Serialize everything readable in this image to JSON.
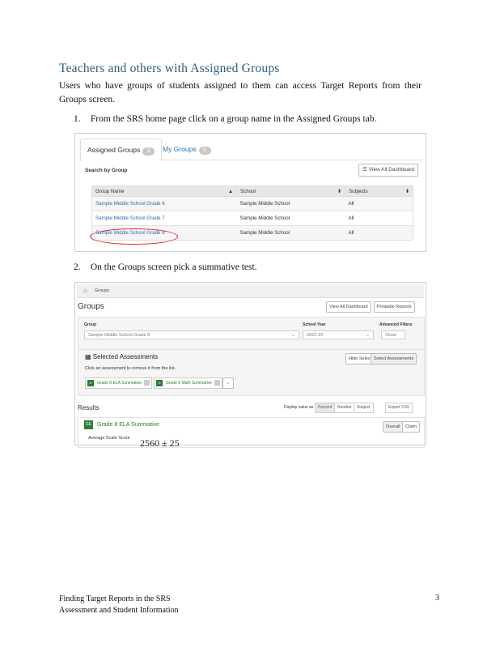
{
  "heading": "Teachers and  others with Assigned Groups",
  "intro": "Users who have groups of students assigned to them can access Target Reports from their Groups screen.",
  "steps": [
    {
      "num": "1.",
      "text": "From the SRS home page click on a group name in the Assigned Groups tab."
    },
    {
      "num": "2.",
      "text": "On the Groups screen pick a summative test."
    }
  ],
  "shot1": {
    "tabs": [
      {
        "label": "Assigned Groups",
        "count": "3"
      },
      {
        "label": "My Groups",
        "count": "0"
      }
    ],
    "search_label": "Search by Group",
    "view_all": "View All Dashboard",
    "columns": [
      "Group Name",
      "School",
      "Subjects"
    ],
    "rows": [
      [
        "Sample Middle School Grade 6",
        "Sample Middle School",
        "All"
      ],
      [
        "Sample Middle School Grade 7",
        "Sample Middle School",
        "All"
      ],
      [
        "Sample Middle School Grade 8",
        "Sample Middle School",
        "All"
      ]
    ]
  },
  "shot2": {
    "breadcrumb": "Groups",
    "title": "Groups",
    "btn_dashboard": "View All Dashboard",
    "btn_print": "Printable Reports",
    "filter_group_label": "Group",
    "filter_group_value": "Sample Middle School Grade 8",
    "filter_year_label": "School Year",
    "filter_year_value": "2022-23",
    "filter_adv_label": "Advanced Filters",
    "filter_adv_value": "Show",
    "sa_title": "Selected Assessments",
    "sa_sub": "Click an assessment to remove it from the list.",
    "btn_hide": "Hide Select",
    "btn_select": "Select Assessments",
    "chips": [
      "Grade 8 ELA Summative",
      "Grade 8 Math Summative"
    ],
    "results": "Results",
    "display_label": "Display value as",
    "seg": [
      "Percent",
      "Number"
    ],
    "btn_subject": "Subject",
    "btn_export": "Export CSV",
    "ge_badge": "GE",
    "ela_title": "Grade 8 ELA Summative",
    "btn_overall": "Overall",
    "btn_claim": "Claim",
    "avg_label": "Average Scale Score",
    "score": "2560 ± 25"
  },
  "footer": [
    "Finding Target Reports in the SRS",
    "Assessment and Student Information"
  ],
  "page_number": "3",
  "colors": {
    "heading": "#2f5d7c",
    "link": "#2a6fb0",
    "highlight": "#dd2222",
    "ela_green": "#2e7d32"
  }
}
